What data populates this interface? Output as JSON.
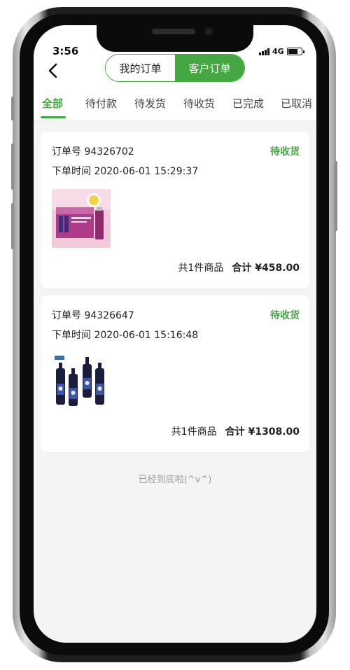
{
  "status_bar": {
    "time": "3:56",
    "network": "4G"
  },
  "header": {
    "segments": [
      {
        "label": "我的订单",
        "active": false
      },
      {
        "label": "客户订单",
        "active": true
      }
    ]
  },
  "tabs": [
    {
      "label": "全部",
      "active": true
    },
    {
      "label": "待付款",
      "active": false
    },
    {
      "label": "待发货",
      "active": false
    },
    {
      "label": "待收货",
      "active": false
    },
    {
      "label": "已完成",
      "active": false
    },
    {
      "label": "已取消",
      "active": false
    }
  ],
  "orders": [
    {
      "order_label": "订单号 94326702",
      "time_label": "下单时间 2020-06-01 15:29:37",
      "status": "待收货",
      "count_text": "共1件商品",
      "total_text": "合计 ¥458.00",
      "image": "product-box-image"
    },
    {
      "order_label": "订单号 94326647",
      "time_label": "下单时间 2020-06-01 15:16:48",
      "status": "待收货",
      "count_text": "共1件商品",
      "total_text": "合计 ¥1308.00",
      "image": "product-bottles-image"
    }
  ],
  "footer_note": "已经到底啦(^v^)",
  "colors": {
    "accent": "#45a741",
    "background": "#f4f4f4"
  },
  "icons": {
    "back": "chevron-left-icon",
    "signal": "signal-bars-icon",
    "battery": "battery-icon"
  }
}
